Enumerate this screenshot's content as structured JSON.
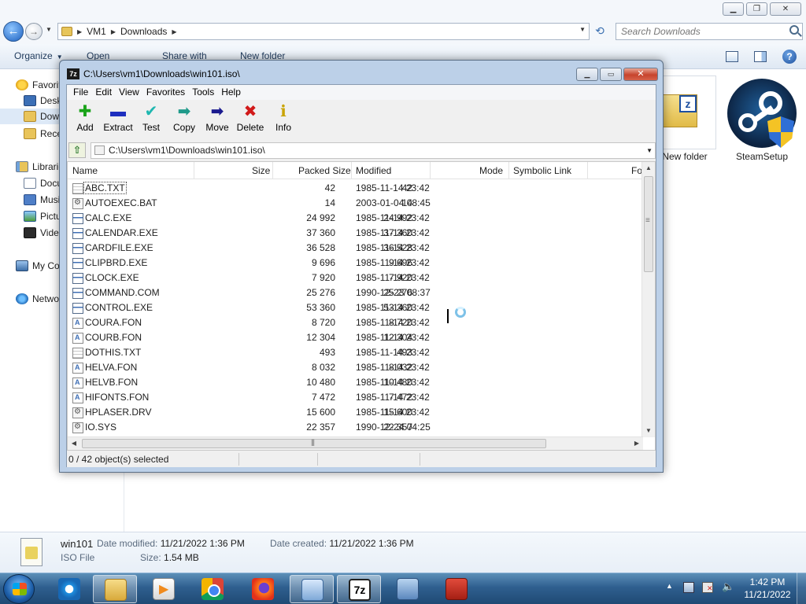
{
  "explorer": {
    "breadcrumb": [
      "VM1",
      "Downloads"
    ],
    "search_placeholder": "Search Downloads",
    "commands": {
      "organize": "Organize",
      "open": "Open",
      "share_with": "Share with",
      "new_folder": "New folder"
    },
    "nav": {
      "favorites": "Favorites",
      "desktop": "Desktop",
      "downloads": "Downloads",
      "recent": "Recent Places",
      "libraries": "Libraries",
      "documents": "Documents",
      "music": "Music",
      "pictures": "Pictures",
      "videos": "Videos",
      "computer": "My Computer",
      "network": "Network"
    },
    "items": {
      "new_folder_label": "New folder",
      "steam_label": "SteamSetup"
    },
    "details": {
      "name": "win101",
      "type": "ISO File",
      "modified_label": "Date modified:",
      "modified_value": "11/21/2022 1:36 PM",
      "created_label": "Date created:",
      "created_value": "11/21/2022 1:36 PM",
      "size_label": "Size:",
      "size_value": "1.54 MB"
    }
  },
  "sevenzip": {
    "title": "C:\\Users\\vm1\\Downloads\\win101.iso\\",
    "app_icon": "7z",
    "menu": [
      "File",
      "Edit",
      "View",
      "Favorites",
      "Tools",
      "Help"
    ],
    "toolbar": [
      {
        "label": "Add",
        "icon": "plus-icon",
        "glyph": "✚",
        "color": "#1aa31a"
      },
      {
        "label": "Extract",
        "icon": "minus-icon",
        "glyph": "▬",
        "color": "#1e2fbf"
      },
      {
        "label": "Test",
        "icon": "check-icon",
        "glyph": "✔",
        "color": "#1fb7b0"
      },
      {
        "label": "Copy",
        "icon": "copy-arrow-icon",
        "glyph": "➡",
        "color": "#1f9a8a"
      },
      {
        "label": "Move",
        "icon": "move-arrow-icon",
        "glyph": "➡",
        "color": "#1b1b8f"
      },
      {
        "label": "Delete",
        "icon": "delete-x-icon",
        "glyph": "✖",
        "color": "#d11919"
      },
      {
        "label": "Info",
        "icon": "info-icon",
        "glyph": "ℹ",
        "color": "#c9a300"
      }
    ],
    "path": "C:\\Users\\vm1\\Downloads\\win101.iso\\",
    "columns": [
      "Name",
      "Size",
      "Packed Size",
      "Modified",
      "Mode",
      "Symbolic Link",
      "Fol"
    ],
    "files": [
      {
        "name": "ABC.TXT",
        "type": "txt",
        "size": "42",
        "packed": "42",
        "modified": "1985-11-14 23:42"
      },
      {
        "name": "AUTOEXEC.BAT",
        "type": "bat",
        "size": "14",
        "packed": "14",
        "modified": "2003-01-04 08:45"
      },
      {
        "name": "CALC.EXE",
        "type": "exe",
        "size": "24 992",
        "packed": "24 992",
        "modified": "1985-11-14 23:42"
      },
      {
        "name": "CALENDAR.EXE",
        "type": "exe",
        "size": "37 360",
        "packed": "37 360",
        "modified": "1985-11-14 23:42"
      },
      {
        "name": "CARDFILE.EXE",
        "type": "exe",
        "size": "36 528",
        "packed": "36 528",
        "modified": "1985-11-14 23:42"
      },
      {
        "name": "CLIPBRD.EXE",
        "type": "exe",
        "size": "9 696",
        "packed": "9 696",
        "modified": "1985-11-14 23:42"
      },
      {
        "name": "CLOCK.EXE",
        "type": "exe",
        "size": "7 920",
        "packed": "7 920",
        "modified": "1985-11-14 23:42"
      },
      {
        "name": "COMMAND.COM",
        "type": "exe",
        "size": "25 276",
        "packed": "25 276",
        "modified": "1990-12-23 08:37"
      },
      {
        "name": "CONTROL.EXE",
        "type": "exe",
        "size": "53 360",
        "packed": "53 360",
        "modified": "1985-11-14 23:42"
      },
      {
        "name": "COURA.FON",
        "type": "fon",
        "size": "8 720",
        "packed": "8 720",
        "modified": "1985-11-14 23:42"
      },
      {
        "name": "COURB.FON",
        "type": "fon",
        "size": "12 304",
        "packed": "12 304",
        "modified": "1985-11-14 23:42"
      },
      {
        "name": "DOTHIS.TXT",
        "type": "txt",
        "size": "493",
        "packed": "493",
        "modified": "1985-11-14 23:42"
      },
      {
        "name": "HELVA.FON",
        "type": "fon",
        "size": "8 032",
        "packed": "8 032",
        "modified": "1985-11-14 23:42"
      },
      {
        "name": "HELVB.FON",
        "type": "fon",
        "size": "10 480",
        "packed": "10 480",
        "modified": "1985-11-14 23:42"
      },
      {
        "name": "HIFONTS.FON",
        "type": "fon",
        "size": "7 472",
        "packed": "7 472",
        "modified": "1985-11-14 23:42"
      },
      {
        "name": "HPLASER.DRV",
        "type": "bat",
        "size": "15 600",
        "packed": "15 600",
        "modified": "1985-11-14 23:42"
      },
      {
        "name": "IO.SYS",
        "type": "bat",
        "size": "22 357",
        "packed": "22 357",
        "modified": "1990-12-24 04:25"
      }
    ],
    "status": "0 / 42 object(s) selected"
  },
  "taskbar": {
    "apps": [
      {
        "name": "internet-explorer",
        "glyph": ""
      },
      {
        "name": "windows-explorer",
        "glyph": ""
      },
      {
        "name": "media-player",
        "glyph": ""
      },
      {
        "name": "chrome",
        "glyph": ""
      },
      {
        "name": "firefox",
        "glyph": ""
      },
      {
        "name": "control-panel",
        "glyph": ""
      },
      {
        "name": "7zip",
        "glyph": "7z"
      },
      {
        "name": "remote-desktop",
        "glyph": ""
      },
      {
        "name": "toolbox",
        "glyph": ""
      }
    ],
    "time": "1:42 PM",
    "date": "11/21/2022"
  }
}
